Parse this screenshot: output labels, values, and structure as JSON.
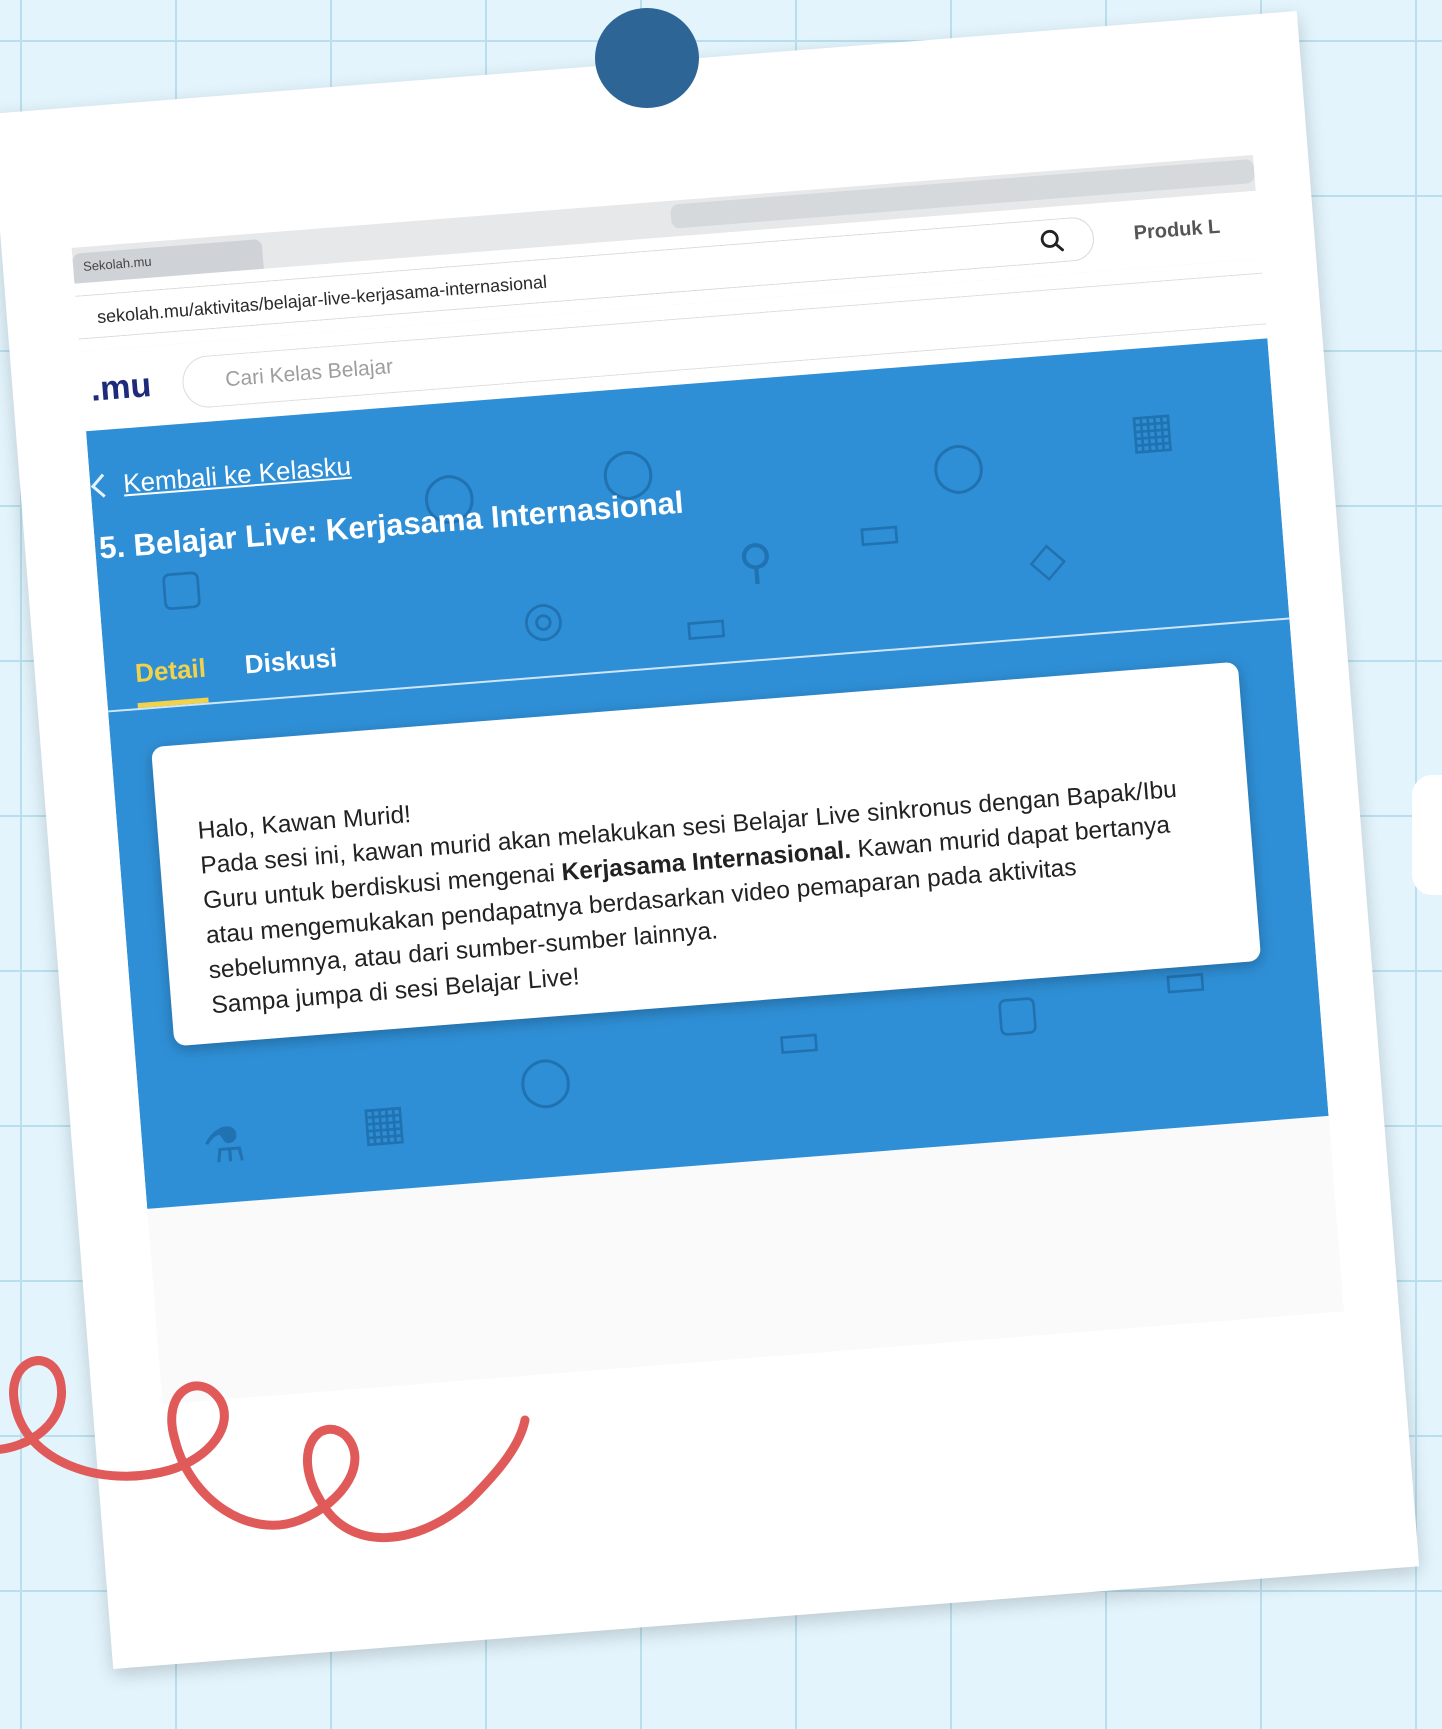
{
  "browser": {
    "tab_title": "Sekolah.mu",
    "url": "sekolah.mu/aktivitas/belajar-live-kerjasama-internasional",
    "right_label": "Produk L"
  },
  "navbar": {
    "logo": ".mu",
    "search_placeholder": "Cari Kelas Belajar"
  },
  "page": {
    "back_link": "Kembali ke Kelasku",
    "title": "5. Belajar Live: Kerjasama Internasional",
    "tabs": [
      {
        "label": "Detail",
        "active": true
      },
      {
        "label": "Diskusi",
        "active": false
      }
    ]
  },
  "card": {
    "greeting": "Halo, Kawan Murid!",
    "text_before_bold": "Pada sesi ini, kawan murid akan melakukan sesi Belajar Live sinkronus dengan Bapak/Ibu Guru untuk berdiskusi mengenai ",
    "bold_text": "Kerjasama Internasional.",
    "text_after_bold": " Kawan murid dapat bertanya atau mengemukakan pendapatnya berdasarkan video pemaparan pada aktivitas sebelumnya, atau dari sumber-sumber lainnya.",
    "closing": "Sampa jumpa di sesi Belajar Live!"
  },
  "colors": {
    "hero_blue": "#2f8fd6",
    "active_tab": "#f2d24a",
    "pin": "#2d6596",
    "squiggle": "#e05a5a",
    "grid_bg": "#e3f4fc"
  }
}
